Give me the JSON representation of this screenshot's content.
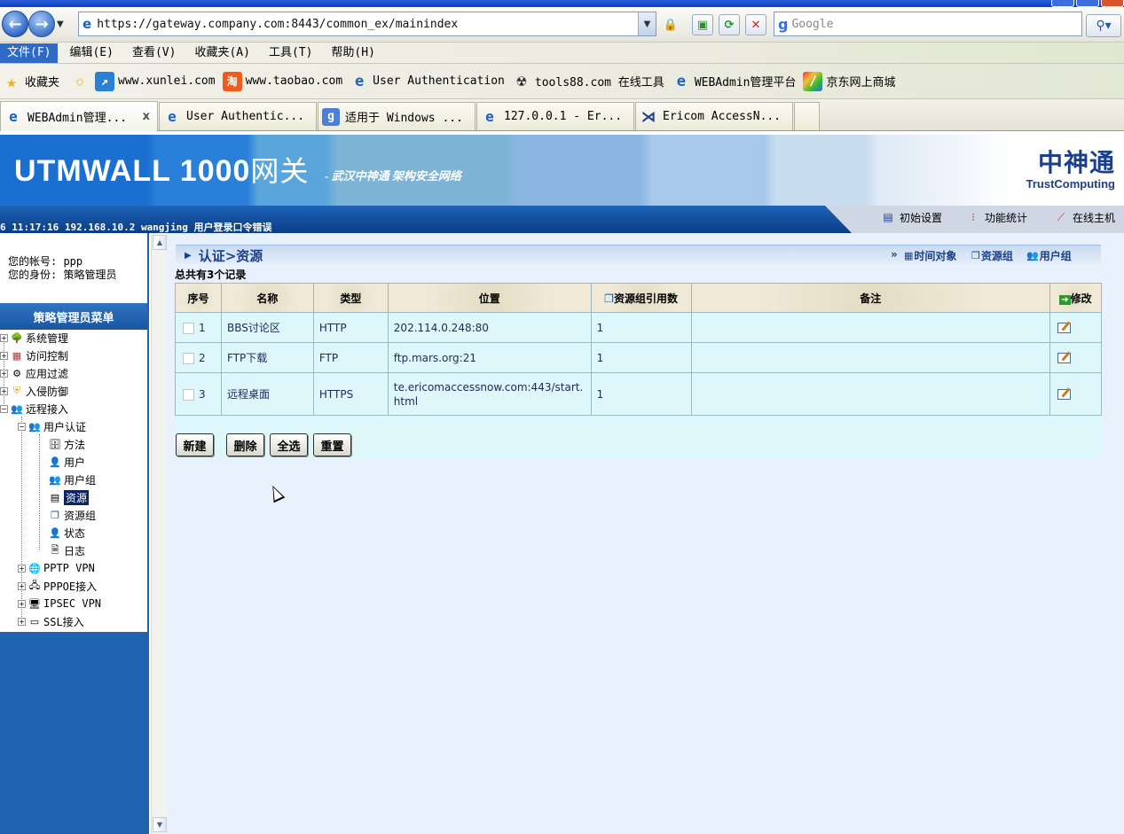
{
  "browser": {
    "url": "https://gateway.company.com:8443/common_ex/mainindex",
    "search_placeholder": "Google",
    "menu": [
      "文件(F)",
      "编辑(E)",
      "查看(V)",
      "收藏夹(A)",
      "工具(T)",
      "帮助(H)"
    ],
    "favorites_label": "收藏夹",
    "favorites": [
      {
        "label": "www.xunlei.com",
        "icon": "xunlei-icon"
      },
      {
        "label": "www.taobao.com",
        "icon": "taobao-icon"
      },
      {
        "label": "User Authentication",
        "icon": "ie-icon"
      },
      {
        "label": "tools88.com 在线工具",
        "icon": "radiation-icon"
      },
      {
        "label": "WEBAdmin管理平台",
        "icon": "ie-icon"
      },
      {
        "label": "京东网上商城",
        "icon": "jd-icon"
      }
    ],
    "tabs": [
      {
        "label": "WEBAdmin管理...",
        "icon": "ie-icon",
        "close": "x"
      },
      {
        "label": "User Authentic...",
        "icon": "ie-icon"
      },
      {
        "label": "适用于 Windows ...",
        "icon": "google-icon"
      },
      {
        "label": "127.0.0.1 - Er...",
        "icon": "ie-icon"
      },
      {
        "label": "Ericom AccessN...",
        "icon": "ericom-icon"
      }
    ]
  },
  "header": {
    "product": "UTMWALL 1000",
    "product_cn": "网关",
    "slogan": "- 武汉中神通 架构安全网络",
    "logo_cn": "中神通",
    "logo_en": "TrustComputing",
    "status_line": "6 11:17:16 192.168.10.2 wangjing 用户登录口令错误",
    "top_links": [
      "初始设置",
      "功能统计",
      "在线主机"
    ]
  },
  "account": {
    "account_line": "您的帐号: ppp",
    "role_line": "您的身份: 策略管理员"
  },
  "sidebar": {
    "title": "策略管理员菜单",
    "items": [
      {
        "label": "系统管理"
      },
      {
        "label": "访问控制"
      },
      {
        "label": "应用过滤"
      },
      {
        "label": "入侵防御"
      },
      {
        "label": "远程接入"
      },
      {
        "label": "用户认证"
      },
      {
        "label": "方法"
      },
      {
        "label": "用户"
      },
      {
        "label": "用户组"
      },
      {
        "label": "资源",
        "selected": true
      },
      {
        "label": "资源组"
      },
      {
        "label": "状态"
      },
      {
        "label": "日志"
      },
      {
        "label": "PPTP VPN"
      },
      {
        "label": "PPPOE接入"
      },
      {
        "label": "IPSEC VPN"
      },
      {
        "label": "SSL接入"
      }
    ]
  },
  "main": {
    "breadcrumb": "认证>资源",
    "right_links_prefix": "»",
    "right_links": [
      "时间对象",
      "资源组",
      "用户组"
    ],
    "total": "总共有3个记录",
    "columns": [
      "序号",
      "名称",
      "类型",
      "位置",
      "资源组引用数",
      "备注",
      "修改"
    ],
    "rows": [
      {
        "no": "1",
        "name": "BBS讨论区",
        "type": "HTTP",
        "location": "202.114.0.248:80",
        "refs": "1",
        "note": ""
      },
      {
        "no": "2",
        "name": "FTP下载",
        "type": "FTP",
        "location": "ftp.mars.org:21",
        "refs": "1",
        "note": ""
      },
      {
        "no": "3",
        "name": "远程桌面",
        "type": "HTTPS",
        "location": "te.ericomaccessnow.com:443/start.html",
        "refs": "1",
        "note": ""
      }
    ],
    "buttons": [
      "新建",
      "删除",
      "全选",
      "重置"
    ]
  }
}
